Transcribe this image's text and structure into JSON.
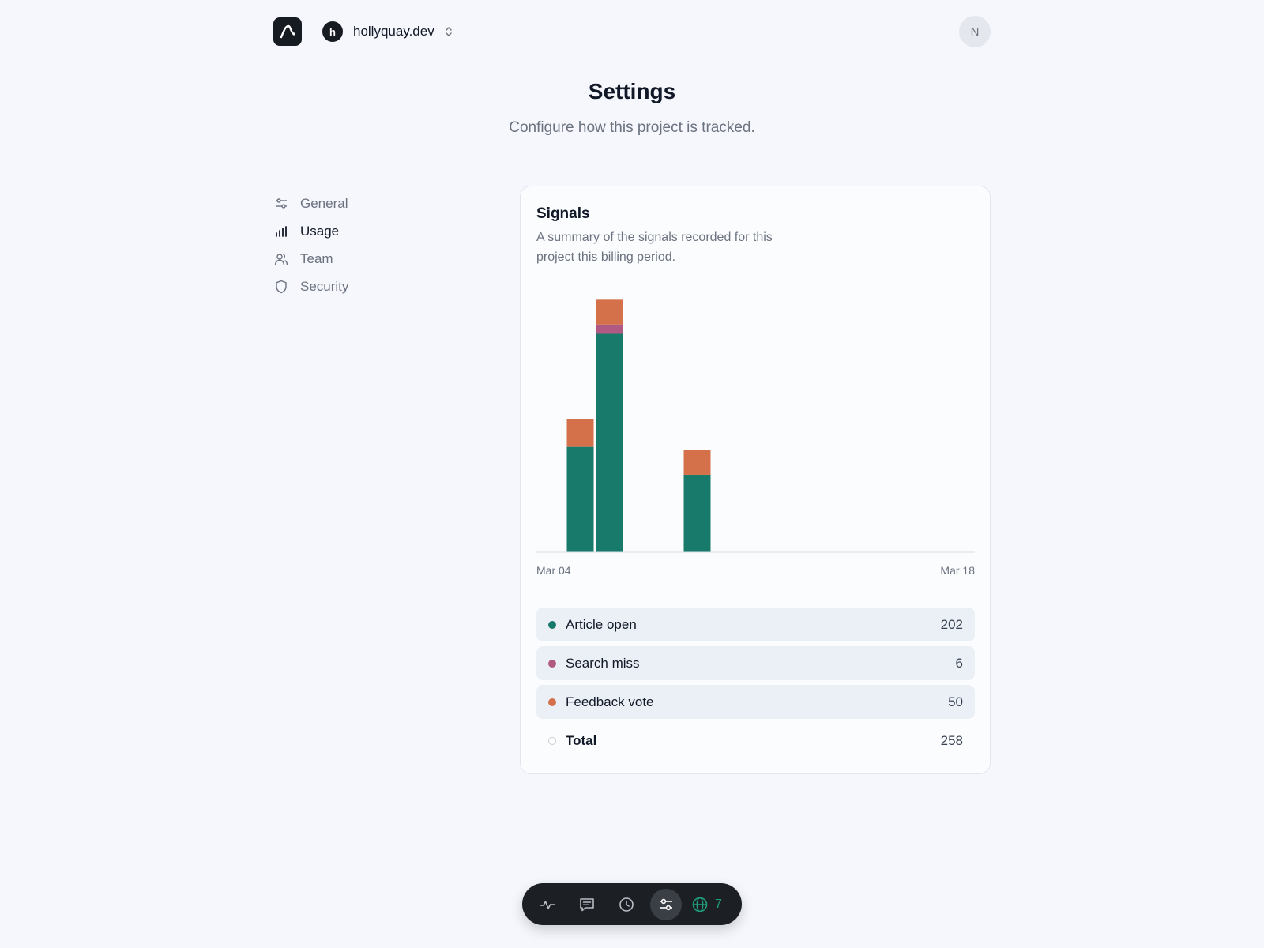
{
  "header": {
    "project_initial": "h",
    "project_name": "hollyquay.dev",
    "user_initial": "N"
  },
  "page": {
    "title": "Settings",
    "subtitle": "Configure how this project is tracked."
  },
  "sidebar": {
    "active": "Usage",
    "items": [
      {
        "label": "General",
        "icon": "sliders-icon"
      },
      {
        "label": "Usage",
        "icon": "bar-chart-icon"
      },
      {
        "label": "Team",
        "icon": "users-icon"
      },
      {
        "label": "Security",
        "icon": "shield-icon"
      }
    ]
  },
  "card": {
    "title": "Signals",
    "description": "A summary of the signals recorded for this project this billing period."
  },
  "chart_data": {
    "type": "bar",
    "stacked": true,
    "x_start_label": "Mar 04",
    "x_end_label": "Mar 18",
    "categories": [
      "Mar 04",
      "Mar 05",
      "Mar 06",
      "Mar 07",
      "Mar 08",
      "Mar 09",
      "Mar 10",
      "Mar 11",
      "Mar 12",
      "Mar 13",
      "Mar 14",
      "Mar 15",
      "Mar 16",
      "Mar 17",
      "Mar 18"
    ],
    "ylim": [
      0,
      180
    ],
    "series": [
      {
        "name": "Article open",
        "color": "#177a6a",
        "values": [
          0,
          68,
          141,
          0,
          0,
          50,
          0,
          0,
          0,
          0,
          0,
          0,
          0,
          0,
          0
        ]
      },
      {
        "name": "Search miss",
        "color": "#b05983",
        "values": [
          0,
          0,
          6,
          0,
          0,
          0,
          0,
          0,
          0,
          0,
          0,
          0,
          0,
          0,
          0
        ]
      },
      {
        "name": "Feedback vote",
        "color": "#d4704a",
        "values": [
          0,
          18,
          16,
          0,
          0,
          16,
          0,
          0,
          0,
          0,
          0,
          0,
          0,
          0,
          0
        ]
      }
    ]
  },
  "legend": {
    "rows": [
      {
        "label": "Article open",
        "value": "202",
        "color": "#177a6a"
      },
      {
        "label": "Search miss",
        "value": "6",
        "color": "#b05983"
      },
      {
        "label": "Feedback vote",
        "value": "50",
        "color": "#d4704a"
      }
    ],
    "total_label": "Total",
    "total_value": "258"
  },
  "dock": {
    "items": [
      "activity-icon",
      "message-icon",
      "clock-icon",
      "sliders-icon"
    ],
    "active": "sliders-icon",
    "globe_icon": "globe-icon",
    "count": "7"
  }
}
